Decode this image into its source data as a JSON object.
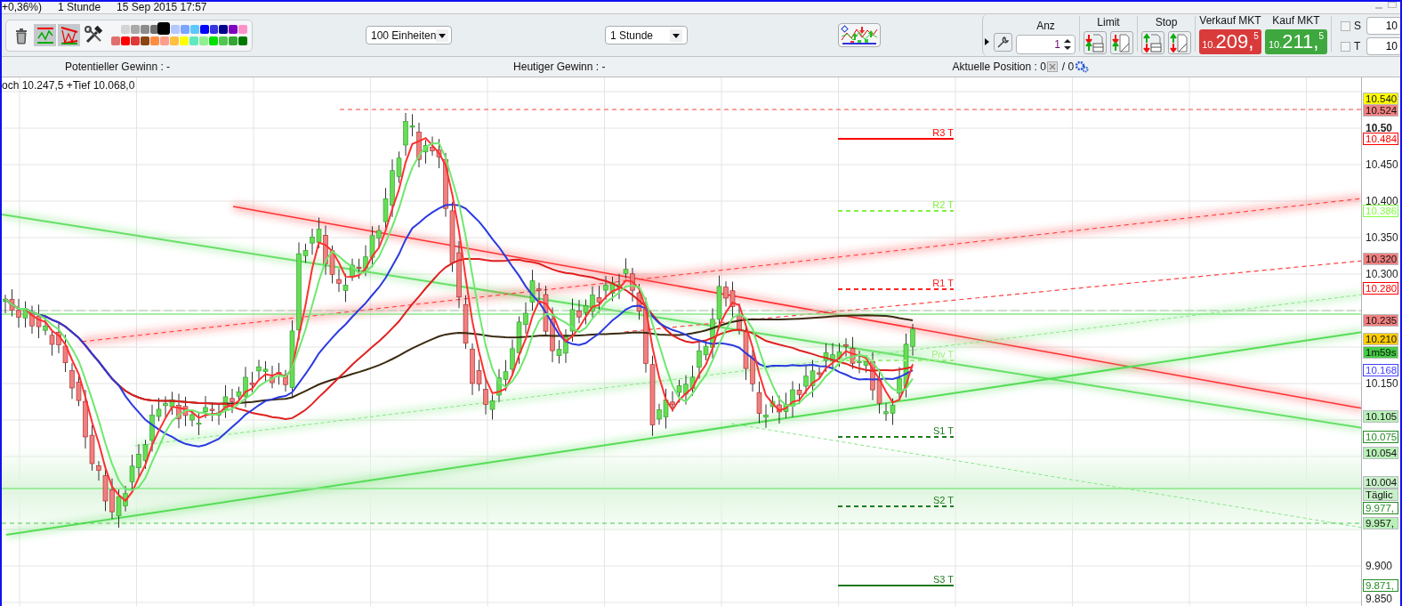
{
  "title_strip": {
    "texts": [
      "+0,36%)",
      "1 Stunde",
      "15 Sep 2015 17:57"
    ]
  },
  "toolbar": {
    "tools": [
      {
        "kind": "trash",
        "selected": false
      },
      {
        "kind": "lines",
        "selected": true
      },
      {
        "kind": "channel",
        "selected": true
      },
      {
        "kind": "tools",
        "selected": false
      }
    ],
    "palette": {
      "top": [
        {
          "color": "#d4d4d4",
          "selected": false
        },
        {
          "color": "#a9a9a9",
          "selected": false
        },
        {
          "color": "#8c8c8c",
          "selected": false
        },
        {
          "color": "#6e6e6e",
          "selected": false
        },
        {
          "color": "#000000",
          "selected": true
        },
        {
          "color": "#b4c8ff",
          "selected": false
        },
        {
          "color": "#7aa4ff",
          "selected": false
        },
        {
          "color": "#5cc8ff",
          "selected": false
        },
        {
          "color": "#0000ff",
          "selected": false
        },
        {
          "color": "#3434e0",
          "selected": false
        },
        {
          "color": "#00008b",
          "selected": false
        },
        {
          "color": "#8000c0",
          "selected": false
        },
        {
          "color": "#ff90c8",
          "selected": false
        }
      ],
      "bottom": [
        {
          "color": "#e07070",
          "selected": false
        },
        {
          "color": "#ff0000",
          "selected": false
        },
        {
          "color": "#e03838",
          "selected": false
        },
        {
          "color": "#8b4513",
          "selected": false
        },
        {
          "color": "#ff8c40",
          "selected": false
        },
        {
          "color": "#ff9c8c",
          "selected": false
        },
        {
          "color": "#ffc040",
          "selected": false
        },
        {
          "color": "#ffff00",
          "selected": false
        },
        {
          "color": "#60e8c0",
          "selected": false
        },
        {
          "color": "#90f090",
          "selected": false
        },
        {
          "color": "#00e000",
          "selected": false
        },
        {
          "color": "#50c850",
          "selected": false
        },
        {
          "color": "#30a830",
          "selected": false
        },
        {
          "color": "#007800",
          "selected": false
        }
      ]
    },
    "units_dropdown": {
      "value": "100 Einheiten"
    },
    "interval_dropdown": {
      "value": "1 Stunde"
    },
    "order_panel": {
      "quantity": {
        "label": "Anz",
        "value": "1"
      },
      "limit": {
        "label": "Limit"
      },
      "stop": {
        "label": "Stop"
      },
      "sell": {
        "label": "Verkauf MKT",
        "prefix": "10.",
        "main": "209,",
        "suffix": "5"
      },
      "buy": {
        "label": "Kauf MKT",
        "prefix": "10.",
        "main": "211,",
        "suffix": "5"
      },
      "options": [
        {
          "label": "S",
          "checked": false,
          "value": "10"
        },
        {
          "label": "T",
          "checked": false,
          "value": "10"
        }
      ]
    }
  },
  "info_bar": {
    "potential": "Potentieller Gewinn : -",
    "today": "Heutiger Gewinn : -",
    "position": "Aktuelle Position : 0",
    "position_suffix": "/ 0"
  },
  "chart": {
    "legend": "och 10.247,5 +Tief 10.068,0",
    "pivots": [
      {
        "label": "R3 T",
        "kind": "solid",
        "color": "#ff0000"
      },
      {
        "label": "R2 T",
        "kind": "dashed",
        "color": "#80f040"
      },
      {
        "label": "R1 T",
        "kind": "dashed",
        "color": "#ff2020"
      },
      {
        "label": "Piv T",
        "kind": "dashed",
        "color": "#a0f080"
      },
      {
        "label": "S1 T",
        "kind": "dashed",
        "color": "#1f7a1f"
      },
      {
        "label": "S2 T",
        "kind": "dashed",
        "color": "#1f7a1f"
      },
      {
        "label": "S3 T",
        "kind": "solid",
        "color": "#1f7a1f"
      }
    ],
    "y_ticks": [
      {
        "label": "10.50",
        "bold": true
      },
      {
        "label": "10.450",
        "bold": false
      },
      {
        "label": "10.400",
        "bold": false
      },
      {
        "label": "10.350",
        "bold": false
      },
      {
        "label": "10.300",
        "bold": false
      },
      {
        "label": "10.150",
        "bold": false
      },
      {
        "label": "9.900",
        "bold": false
      },
      {
        "label": "9.850",
        "bold": false
      }
    ],
    "price_tags": [
      {
        "text": "10.540",
        "kind": "filled",
        "color": "#ffff00"
      },
      {
        "text": "10.524",
        "kind": "filled",
        "color": "#f08080"
      },
      {
        "text": "10.484",
        "kind": "outlined",
        "color": "#ff0000"
      },
      {
        "text": "10.386",
        "kind": "outlined",
        "color": "#80ff40"
      },
      {
        "text": "10.320",
        "kind": "filled",
        "color": "#f08080"
      },
      {
        "text": "10.280",
        "kind": "outlined",
        "color": "#ff0000"
      },
      {
        "text": "10.235",
        "kind": "filled",
        "color": "#f08080"
      },
      {
        "text": "10.210",
        "kind": "filled",
        "color": "#ffcc00"
      },
      {
        "text": "1m59s",
        "kind": "filled",
        "color": "#44cc44"
      },
      {
        "text": "10.168",
        "kind": "outlined",
        "color": "#4040ff"
      },
      {
        "text": "10.105",
        "kind": "filled",
        "color": "#b8f0b8"
      },
      {
        "text": "10.075",
        "kind": "outlined",
        "color": "#228b22"
      },
      {
        "text": "10.054",
        "kind": "filled",
        "color": "#b8f0b8"
      },
      {
        "text": "10.004",
        "kind": "filled",
        "color": "#c8f0c8"
      },
      {
        "text": "Täglic",
        "kind": "filled",
        "color": "#c8f0c8"
      },
      {
        "text": "9.977,",
        "kind": "outlined",
        "color": "#228b22"
      },
      {
        "text": "9.957,",
        "kind": "filled",
        "color": "#b8f0b8"
      },
      {
        "text": "9.871,",
        "kind": "outlined",
        "color": "#228b22"
      }
    ]
  }
}
